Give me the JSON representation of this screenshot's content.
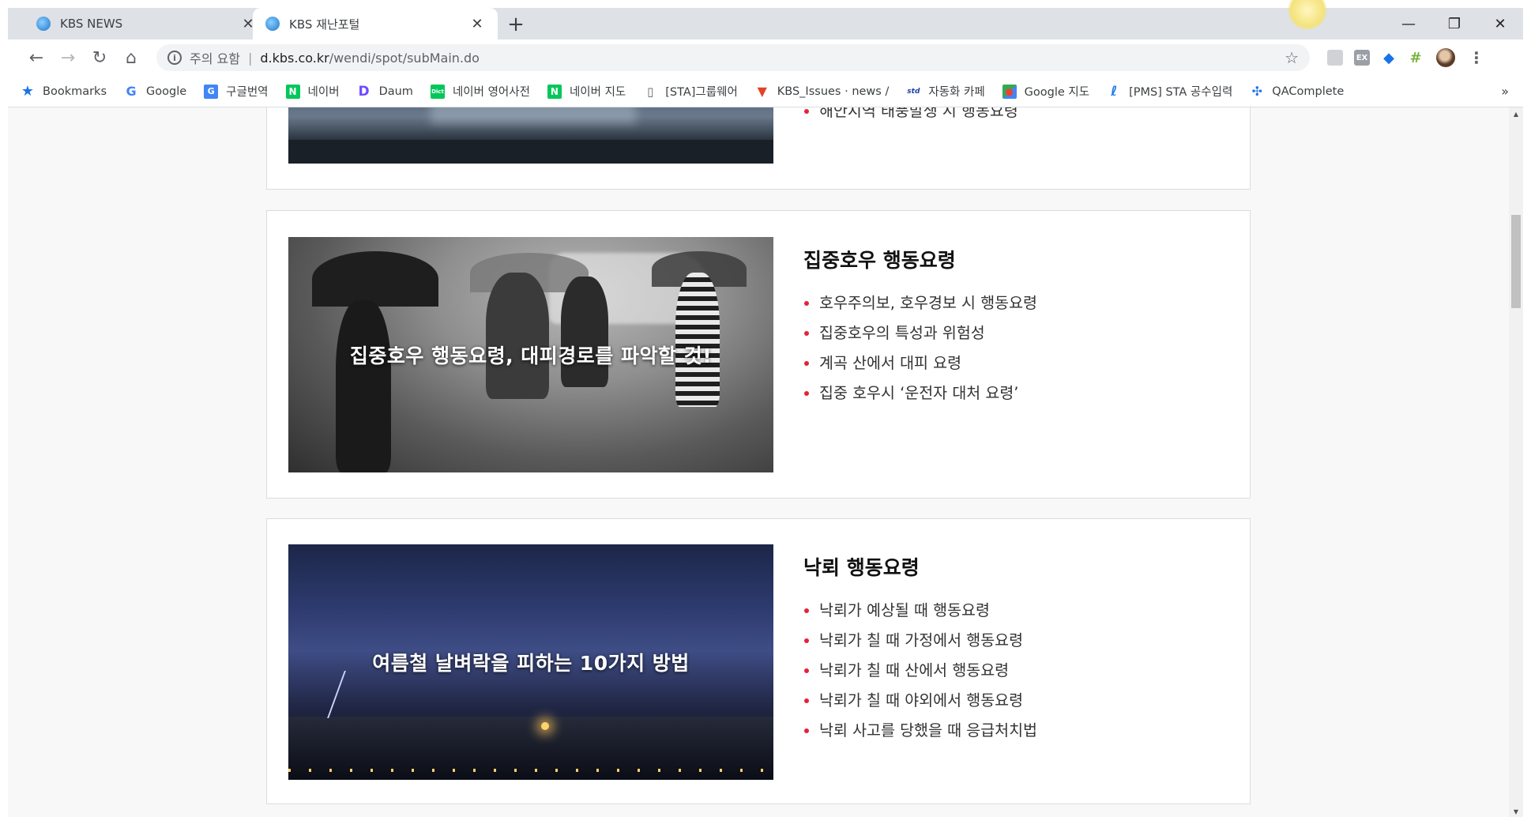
{
  "browser": {
    "tabs": [
      {
        "title": "KBS NEWS",
        "active": false
      },
      {
        "title": "KBS 재난포털",
        "active": true
      }
    ],
    "new_tab": "+",
    "window_controls": {
      "minimize": "—",
      "restore": "❐",
      "close": "✕"
    },
    "address": {
      "security_label": "주의 요함",
      "separator": "|",
      "host": "d.kbs.co.kr",
      "path": "/wendi/spot/subMain.do"
    },
    "bookmarks": [
      {
        "label": "Bookmarks",
        "icon": "star-icon"
      },
      {
        "label": "Google",
        "icon": "google-icon"
      },
      {
        "label": "구글번역",
        "icon": "translate-icon"
      },
      {
        "label": "네이버",
        "icon": "naver-icon"
      },
      {
        "label": "Daum",
        "icon": "daum-icon"
      },
      {
        "label": "네이버 영어사전",
        "icon": "dict-icon"
      },
      {
        "label": "네이버 지도",
        "icon": "naver-icon"
      },
      {
        "label": "[STA]그룹웨어",
        "icon": "document-icon"
      },
      {
        "label": "KBS_Issues · news / ",
        "icon": "gitlab-icon"
      },
      {
        "label": "자동화 카페",
        "icon": "cafe-icon"
      },
      {
        "label": "Google 지도",
        "icon": "maps-icon"
      },
      {
        "label": "[PMS] STA 공수입력",
        "icon": "pms-icon"
      },
      {
        "label": "QAComplete",
        "icon": "qacomplete-icon"
      }
    ],
    "bookmarks_more": "»"
  },
  "page": {
    "cards": [
      {
        "title": "",
        "image_caption": "",
        "items": [
          "해안지역 태풍발생 시 행동요령"
        ]
      },
      {
        "title": "집중호우 행동요령",
        "image_caption": "집중호우 행동요령, 대피경로를 파악할 것!",
        "items": [
          "호우주의보, 호우경보 시 행동요령",
          "집중호우의 특성과 위험성",
          "계곡 산에서 대피 요령",
          "집중 호우시 ‘운전자 대처 요령’"
        ]
      },
      {
        "title": "낙뢰 행동요령",
        "image_caption": "여름철 날벼락을 피하는 10가지 방법",
        "items": [
          "낙뢰가 예상될 때 행동요령",
          "낙뢰가 칠 때 가정에서 행동요령",
          "낙뢰가 칠 때 산에서 행동요령",
          "낙뢰가 칠 때 야외에서 행동요령",
          "낙뢰 사고를 당했을 때 응급처치법"
        ]
      }
    ]
  },
  "colors": {
    "bullet": "#e5223a",
    "page_bg": "#f8f8f8",
    "card_border": "#dcdcdc"
  }
}
